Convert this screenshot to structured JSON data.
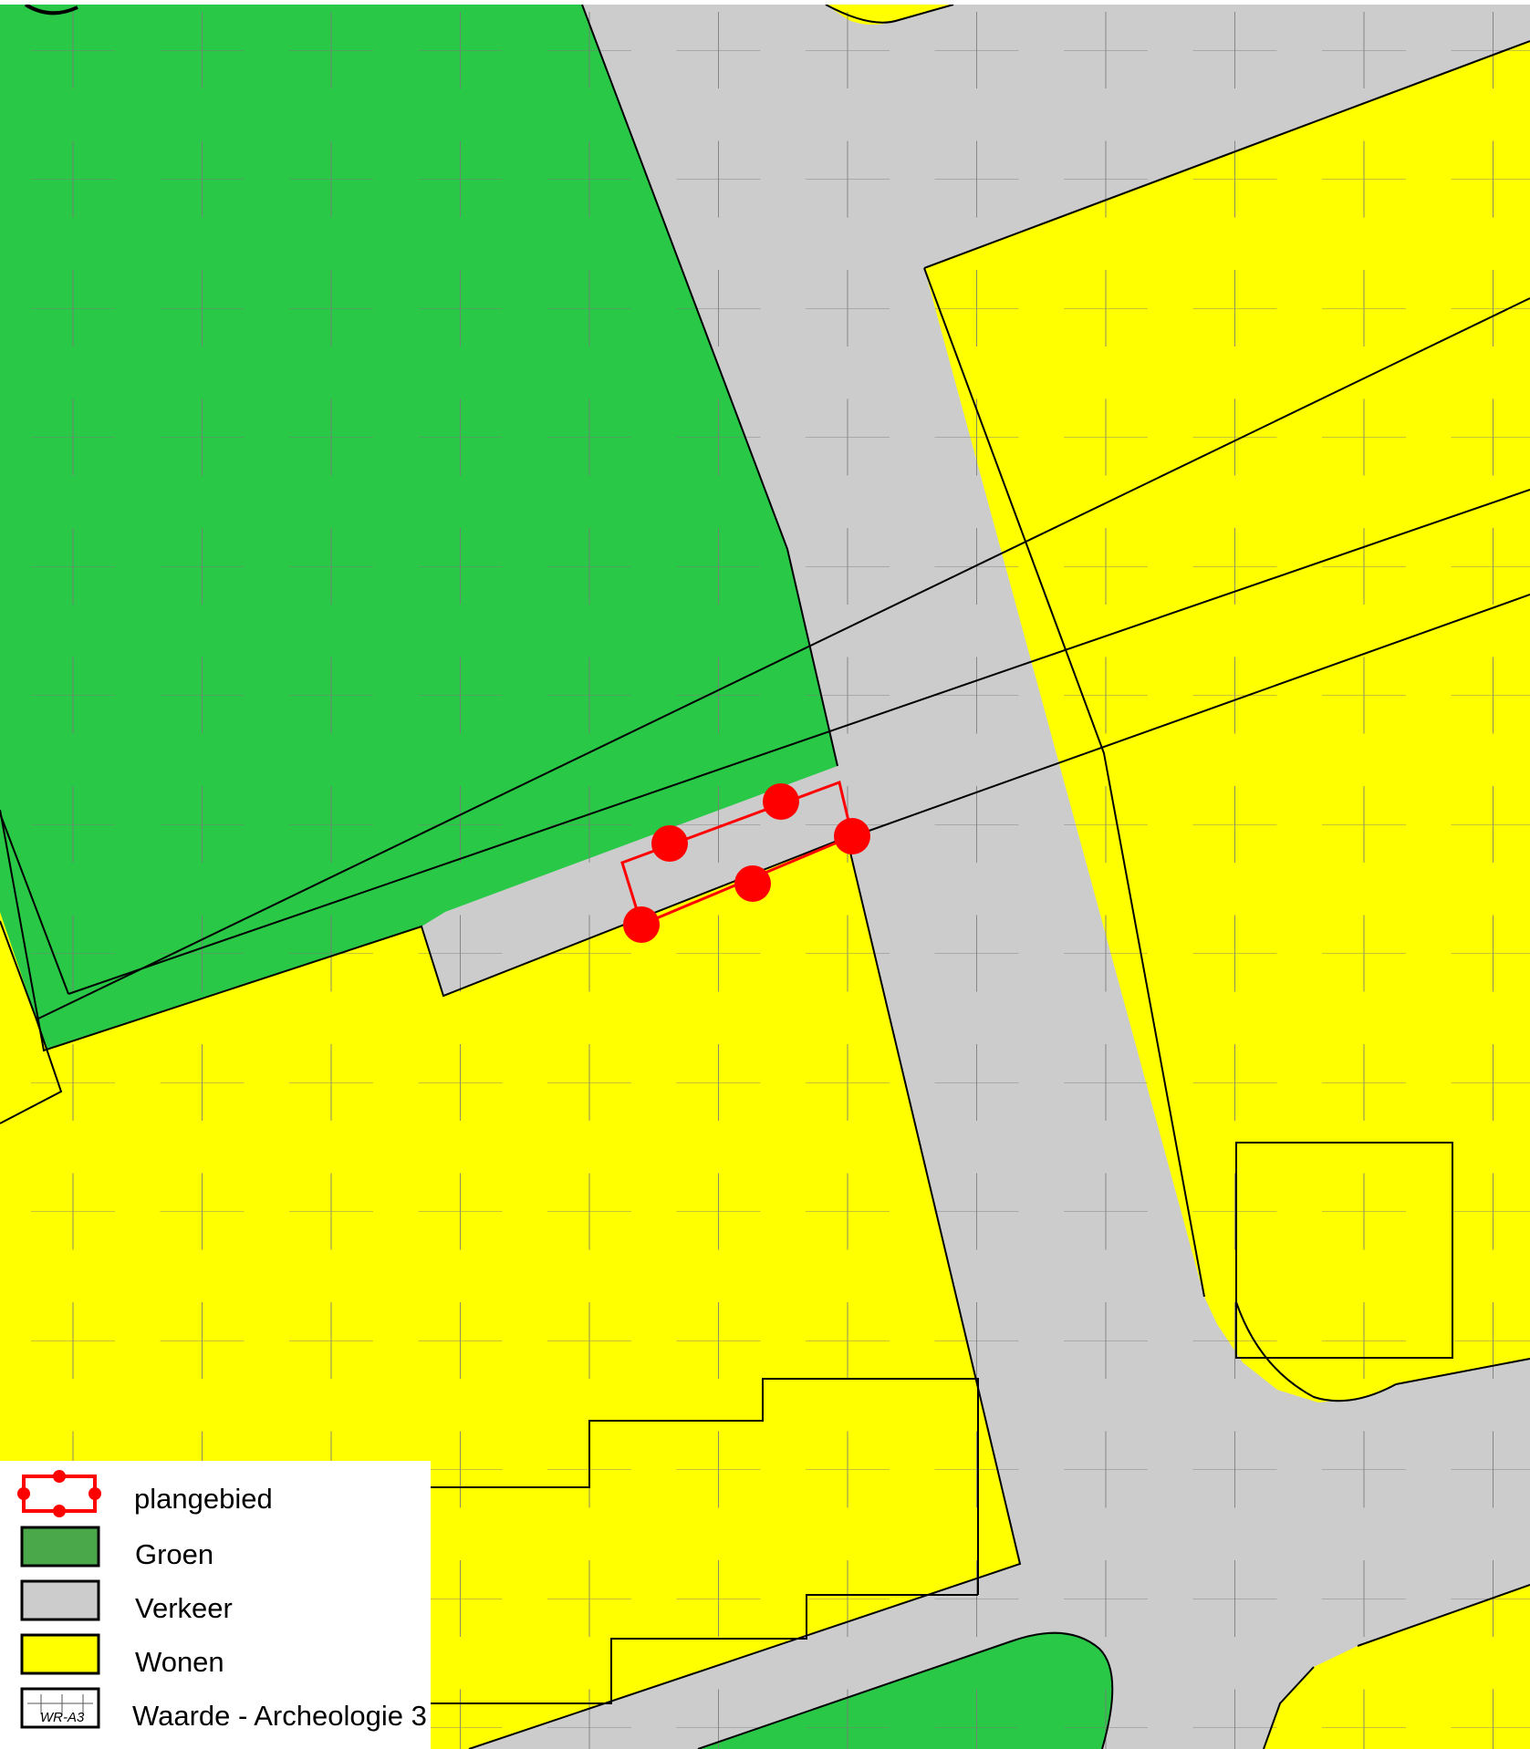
{
  "colors": {
    "groen": "#29c847",
    "verkeer": "#cccccc",
    "wonen": "#ffff00",
    "plangebied": "#ff0000",
    "legend_groen": "#4aa84a",
    "outline": "#000000"
  },
  "legend": {
    "plangebied": "plangebied",
    "groen": "Groen",
    "verkeer": "Verkeer",
    "wonen": "Wonen",
    "archeologie": "Waarde - Archeologie 3",
    "archeologie_code": "WR-A3"
  }
}
